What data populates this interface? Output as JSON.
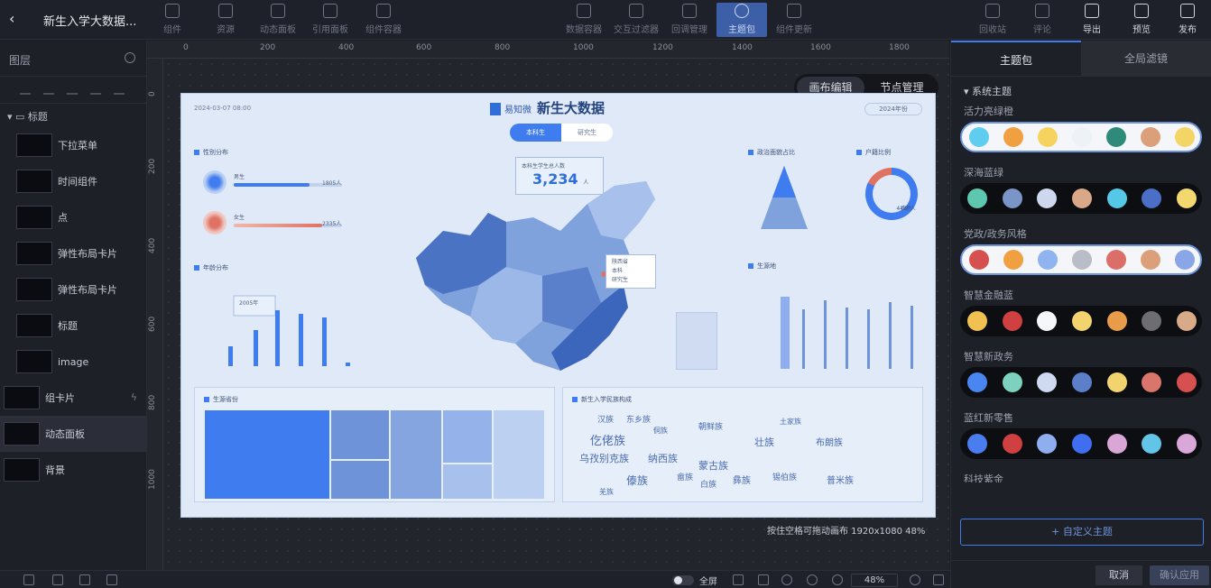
{
  "app": {
    "title": "新生入学大数据..."
  },
  "toolbar_left": [
    {
      "label": "组件",
      "icon": "hexagon-icon"
    },
    {
      "label": "资源",
      "icon": "layers-icon"
    },
    {
      "label": "动态面板",
      "icon": "panel-icon"
    },
    {
      "label": "引用面板",
      "icon": "link-icon"
    },
    {
      "label": "组件容器",
      "icon": "container-icon"
    }
  ],
  "toolbar_center": [
    {
      "label": "数据容器",
      "icon": "chart-icon"
    },
    {
      "label": "交互过滤器",
      "icon": "filter-icon"
    },
    {
      "label": "回调管理",
      "icon": "sliders-icon"
    },
    {
      "label": "主题包",
      "icon": "theme-icon",
      "active": true
    },
    {
      "label": "组件更新",
      "icon": "refresh-icon"
    }
  ],
  "toolbar_right": [
    {
      "label": "回收站",
      "icon": "trash-icon"
    },
    {
      "label": "评论",
      "icon": "comment-icon"
    },
    {
      "label": "导出",
      "icon": "export-icon"
    },
    {
      "label": "预览",
      "icon": "preview-icon"
    },
    {
      "label": "发布",
      "icon": "publish-icon"
    }
  ],
  "left_panel": {
    "title": "图层",
    "group": "标题",
    "layers": [
      {
        "label": "下拉菜单"
      },
      {
        "label": "时间组件"
      },
      {
        "label": "点"
      },
      {
        "label": "弹性布局卡片"
      },
      {
        "label": "弹性布局卡片"
      },
      {
        "label": "标题"
      },
      {
        "label": "image"
      }
    ],
    "top_layers": [
      {
        "label": "组卡片"
      },
      {
        "label": "动态面板"
      },
      {
        "label": "背景"
      }
    ]
  },
  "ruler": {
    "top_ticks": [
      "0",
      "200",
      "400",
      "600",
      "800",
      "1000",
      "1200",
      "1400",
      "1600",
      "1800"
    ],
    "left_ticks": [
      "0",
      "200",
      "400",
      "600",
      "800",
      "1000"
    ]
  },
  "mode_switch": {
    "canvas_edit": "画布编辑",
    "node_manage": "节点管理"
  },
  "canvas_hint": "按住空格可拖动画布  1920x1080 48%",
  "dashboard": {
    "date": "2024-03-07 08:00",
    "brand": "易知微",
    "title": "新生大数据",
    "year_select": "2024年份",
    "tabs": [
      "本科生",
      "研究生"
    ],
    "gender_section": "性别分布",
    "male_label": "男生",
    "male_value": "1805人",
    "female_label": "女生",
    "female_value": "2335人",
    "kpi_label": "本科生学生总人数",
    "kpi_value": "3,234",
    "kpi_unit": "人",
    "age_section": "年龄分布",
    "age_tooltip": "2005年",
    "pyramid_section": "政治面貌占比",
    "donut_section": "户籍比例",
    "donut_label": "农村",
    "donut_value": "4487人",
    "thin_section": "生源地",
    "map_tooltip": [
      "陕西省",
      "本科",
      "研究生"
    ],
    "tree_section": "生源省份",
    "words_section": "新生入学民族构成",
    "words": [
      "汉族",
      "东乡族",
      "仡佬族",
      "朝鲜族",
      "壮族",
      "侗族",
      "乌孜别克族",
      "纳西族",
      "蒙古族",
      "布朗族",
      "彝族",
      "傣族",
      "白族",
      "普米族",
      "锡伯族",
      "土家族",
      "畲族",
      "羌族"
    ]
  },
  "right_panel": {
    "tabs": [
      "主题包",
      "全局滤镜"
    ],
    "section": "系统主题",
    "themes": [
      {
        "name": "活力亮绿橙",
        "style": "light",
        "colors": [
          "#5ecdf0",
          "#f0a040",
          "#f6d25e",
          "#eef1f6",
          "#2e8a7a",
          "#dba079",
          "#f3d566"
        ]
      },
      {
        "name": "深海蓝绿",
        "style": "dark",
        "colors": [
          "#5ec7b0",
          "#7a95c8",
          "#cdd8ee",
          "#d8a888",
          "#55c8e8",
          "#4b6fc7",
          "#f2d86f"
        ]
      },
      {
        "name": "党政/政务风格",
        "style": "light",
        "colors": [
          "#d65050",
          "#f0a040",
          "#8fb4f0",
          "#b9bdc8",
          "#dc6e6a",
          "#dba079",
          "#8aa6e6"
        ]
      },
      {
        "name": "智慧金融蓝",
        "style": "dark",
        "colors": [
          "#f0c050",
          "#d04040",
          "#f6f7fa",
          "#f2d36e",
          "#e89b48",
          "#6e6e72",
          "#d9aa88"
        ]
      },
      {
        "name": "智慧新政务",
        "style": "dark",
        "colors": [
          "#4a86f0",
          "#7cd2be",
          "#cfdaf0",
          "#5b7fc8",
          "#f2d36e",
          "#d9756a",
          "#d65050"
        ]
      },
      {
        "name": "蓝红新零售",
        "style": "dark",
        "colors": [
          "#4a7ef0",
          "#d04040",
          "#8eaef0",
          "#3f6ef0",
          "#d9a6d6",
          "#62c4e6",
          "#d9a8d8"
        ]
      }
    ],
    "partial_theme": "科技紫金",
    "custom_button": "+ 自定义主题",
    "cancel": "取消",
    "confirm": "确认应用"
  },
  "bottom_bar": {
    "toggle_label": "全屏",
    "zoom": "48%"
  }
}
